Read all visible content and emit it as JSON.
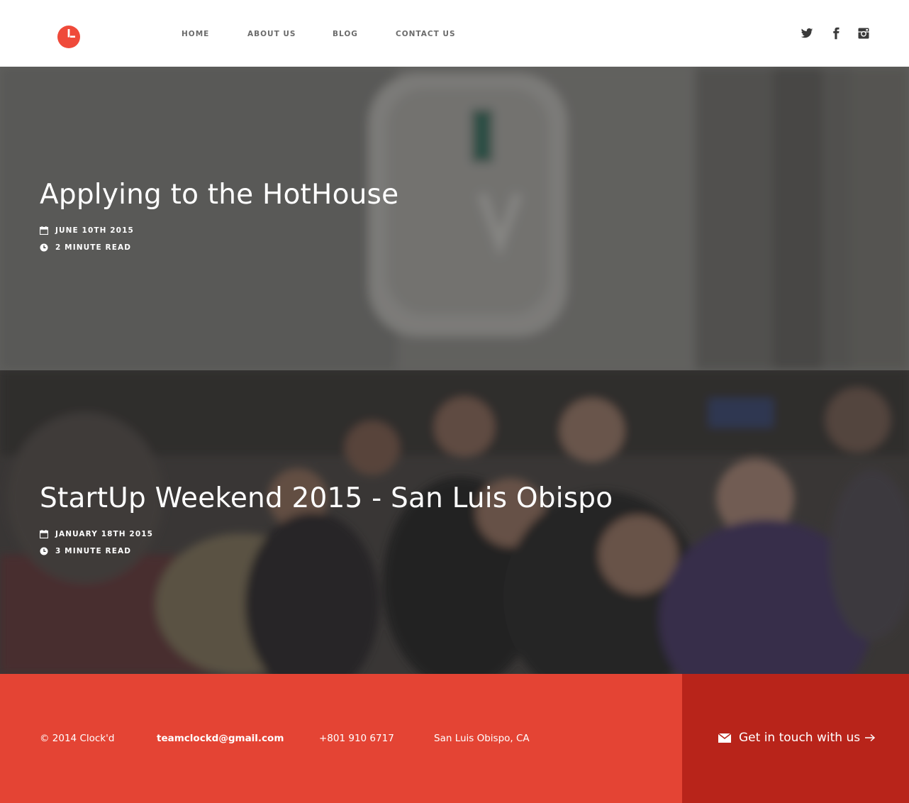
{
  "colors": {
    "brand_red": "#e34435",
    "footer_red": "#e44434",
    "footer_dark_red": "#b8241a",
    "nav_text": "#6b6b6b",
    "icon_dark": "#3a3a3a"
  },
  "header": {
    "logo_icon": "clock-logo-icon",
    "nav": [
      {
        "label": "HOME"
      },
      {
        "label": "ABOUT US"
      },
      {
        "label": "BLOG"
      },
      {
        "label": "CONTACT US"
      }
    ],
    "social": [
      {
        "icon": "twitter-icon"
      },
      {
        "icon": "facebook-icon"
      },
      {
        "icon": "instagram-icon"
      }
    ]
  },
  "posts": [
    {
      "title": "Applying to the HotHouse",
      "date": "JUNE 10TH 2015",
      "read_time": "2 MINUTE READ",
      "date_icon": "calendar-icon",
      "time_icon": "clock-icon"
    },
    {
      "title": "StartUp Weekend 2015 - San Luis Obispo",
      "date": "JANUARY 18TH 2015",
      "read_time": "3 MINUTE READ",
      "date_icon": "calendar-icon",
      "time_icon": "clock-icon"
    }
  ],
  "footer": {
    "copyright": "© 2014 Clock'd",
    "email": "teamclockd@gmail.com",
    "phone": "+801 910 6717",
    "location": "San Luis Obispo, CA",
    "cta_label": "Get in touch with us",
    "cta_icon": "envelope-icon",
    "cta_arrow_icon": "arrow-right-icon"
  }
}
